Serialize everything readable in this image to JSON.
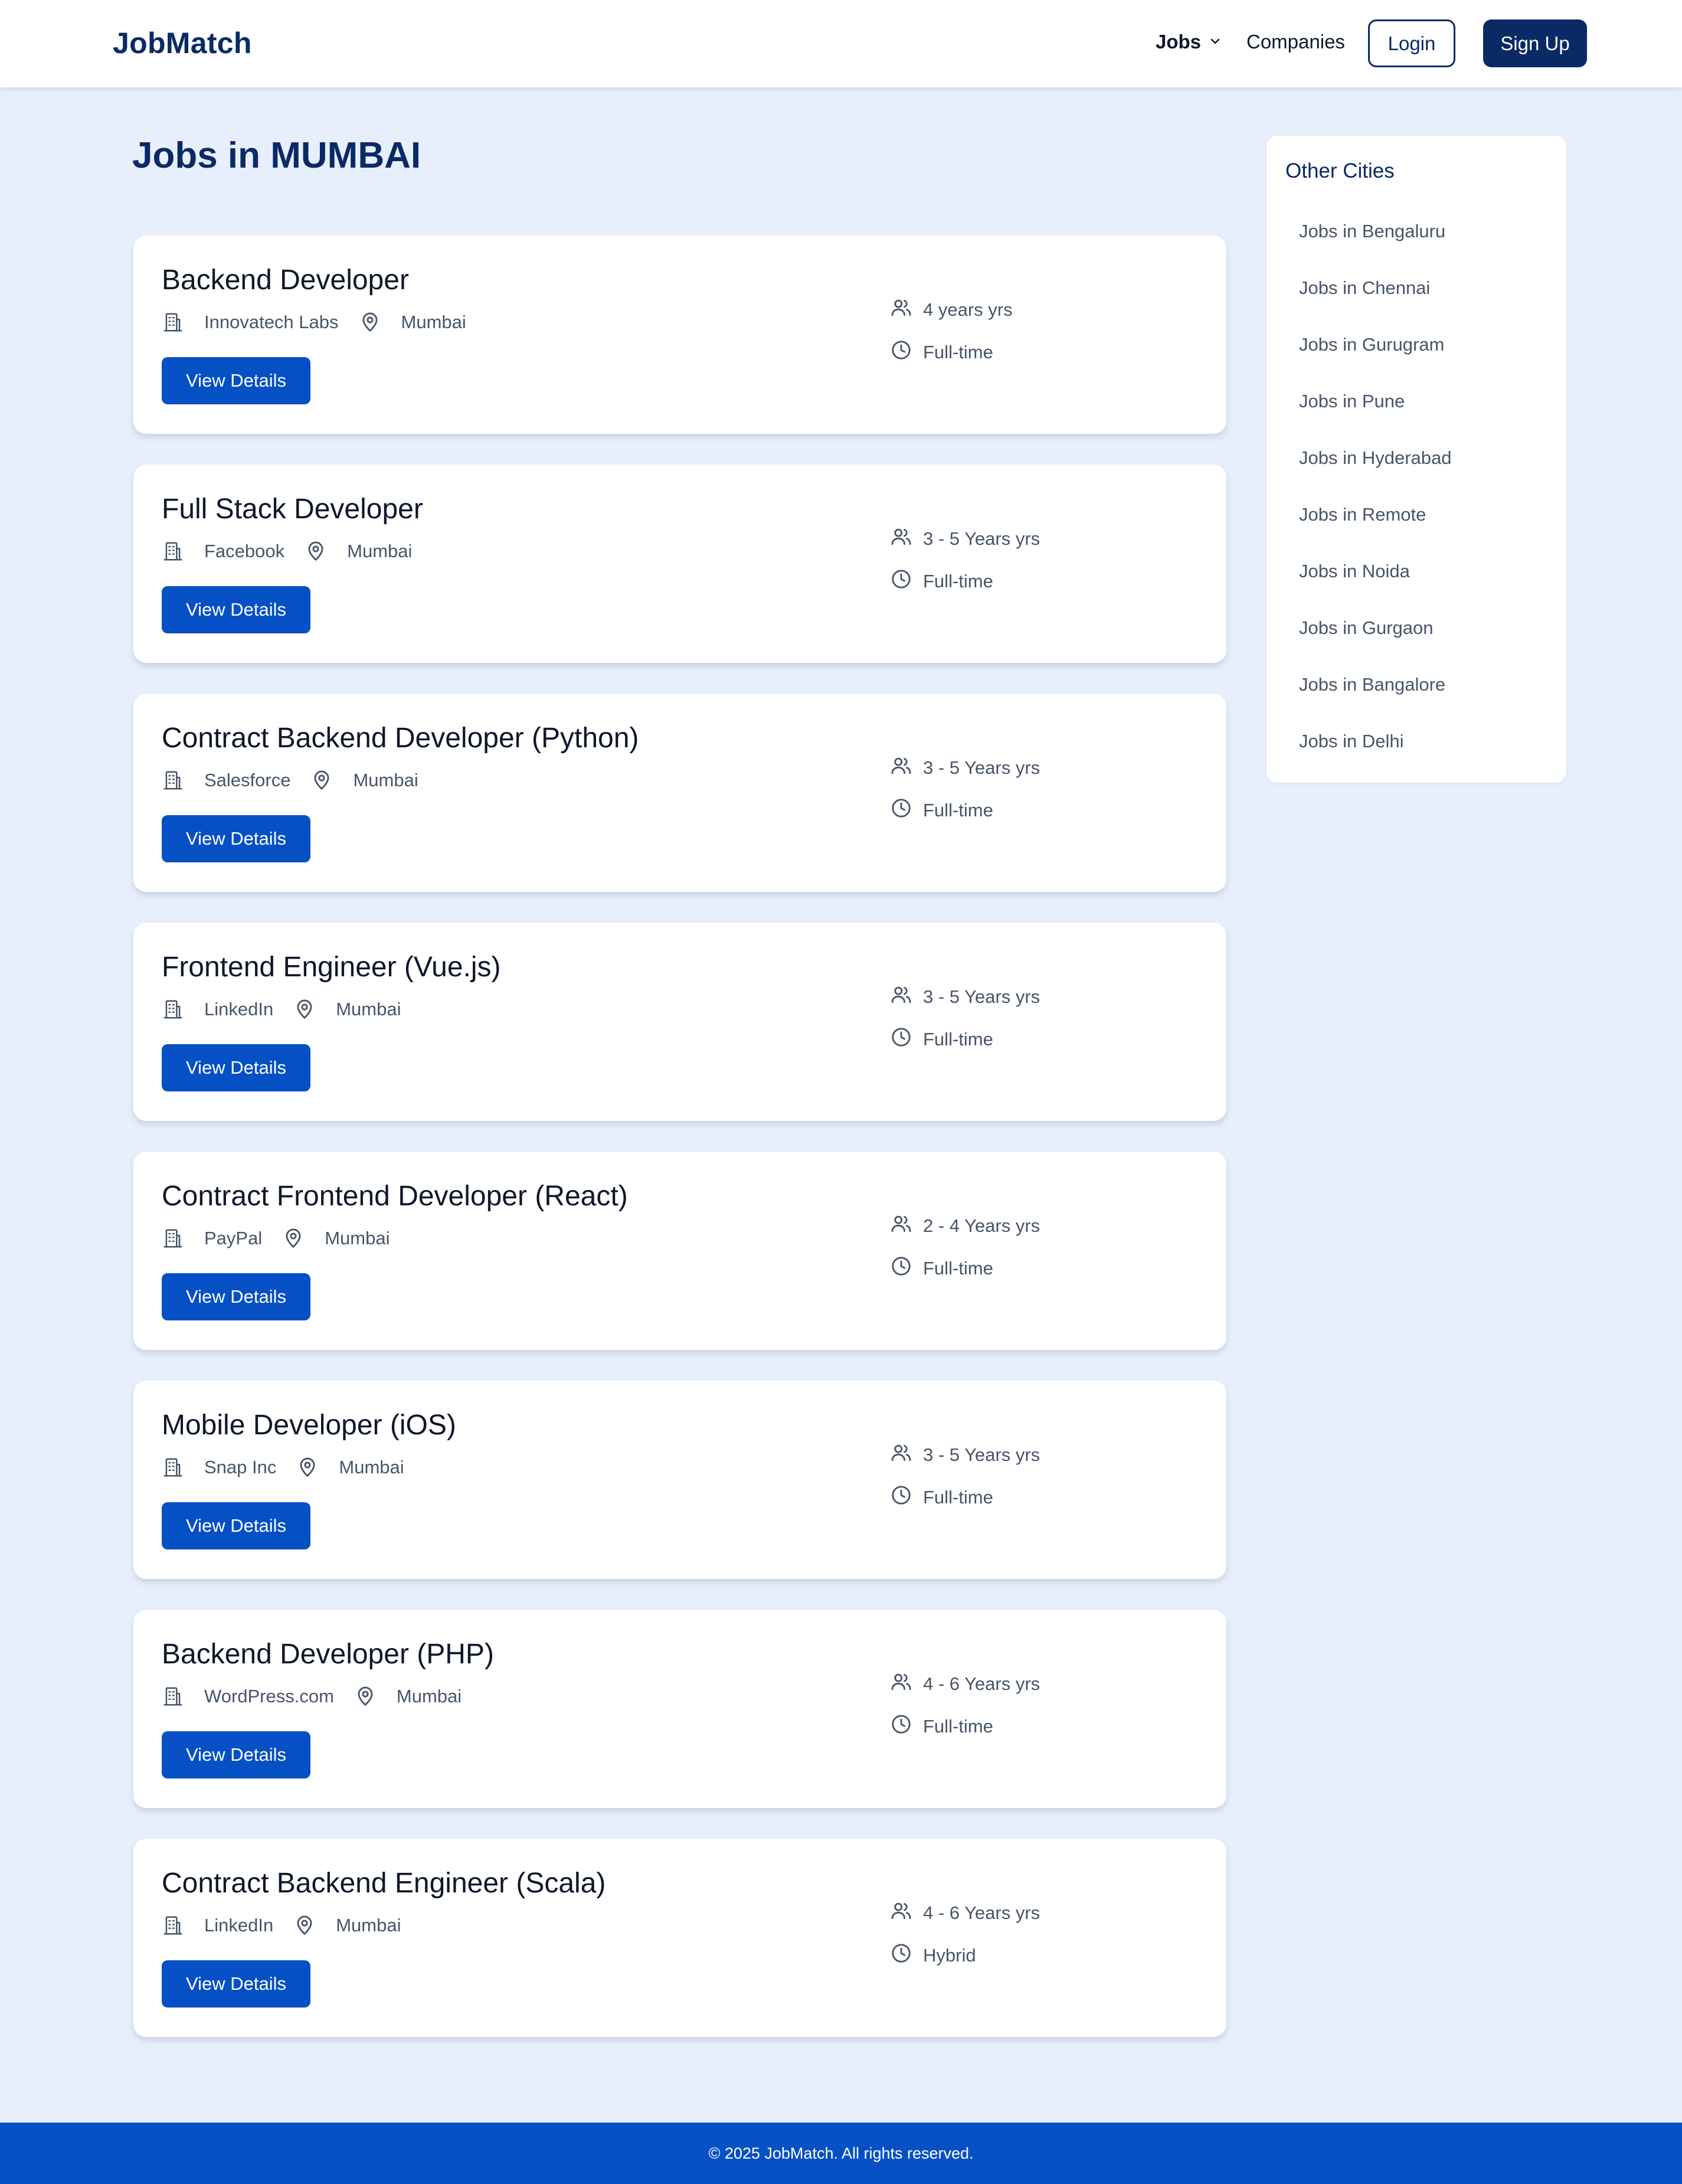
{
  "header": {
    "brand": "JobMatch",
    "nav": {
      "jobs_label": "Jobs",
      "companies_label": "Companies"
    },
    "login_label": "Login",
    "signup_label": "Sign Up"
  },
  "page": {
    "title": "Jobs in MUMBAI"
  },
  "jobs": [
    {
      "title": "Backend Developer",
      "company": "Innovatech Labs",
      "location": "Mumbai",
      "experience": "4 years yrs",
      "type": "Full-time",
      "action": "View Details"
    },
    {
      "title": "Full Stack Developer",
      "company": "Facebook",
      "location": "Mumbai",
      "experience": "3 - 5 Years yrs",
      "type": "Full-time",
      "action": "View Details"
    },
    {
      "title": "Contract Backend Developer (Python)",
      "company": "Salesforce",
      "location": "Mumbai",
      "experience": "3 - 5 Years yrs",
      "type": "Full-time",
      "action": "View Details"
    },
    {
      "title": "Frontend Engineer (Vue.js)",
      "company": "LinkedIn",
      "location": "Mumbai",
      "experience": "3 - 5 Years yrs",
      "type": "Full-time",
      "action": "View Details"
    },
    {
      "title": "Contract Frontend Developer (React)",
      "company": "PayPal",
      "location": "Mumbai",
      "experience": "2 - 4 Years yrs",
      "type": "Full-time",
      "action": "View Details"
    },
    {
      "title": "Mobile Developer (iOS)",
      "company": "Snap Inc",
      "location": "Mumbai",
      "experience": "3 - 5 Years yrs",
      "type": "Full-time",
      "action": "View Details"
    },
    {
      "title": "Backend Developer (PHP)",
      "company": "WordPress.com",
      "location": "Mumbai",
      "experience": "4 - 6 Years yrs",
      "type": "Full-time",
      "action": "View Details"
    },
    {
      "title": "Contract Backend Engineer (Scala)",
      "company": "LinkedIn",
      "location": "Mumbai",
      "experience": "4 - 6 Years yrs",
      "type": "Hybrid",
      "action": "View Details"
    }
  ],
  "sidebar": {
    "title": "Other Cities",
    "cities": [
      "Jobs in Bengaluru",
      "Jobs in Chennai",
      "Jobs in Gurugram",
      "Jobs in Pune",
      "Jobs in Hyderabad",
      "Jobs in Remote",
      "Jobs in Noida",
      "Jobs in Gurgaon",
      "Jobs in Bangalore",
      "Jobs in Delhi"
    ]
  },
  "footer": {
    "text": "© 2025 JobMatch. All rights reserved."
  },
  "icons": {
    "company": "building-icon",
    "location": "map-pin-icon",
    "experience": "users-icon",
    "type": "clock-icon",
    "dropdown": "chevron-down-icon"
  },
  "colors": {
    "primary_dark": "#0a2a66",
    "primary": "#0650c6",
    "page_bg": "#e7effc",
    "muted_text": "#475569"
  }
}
